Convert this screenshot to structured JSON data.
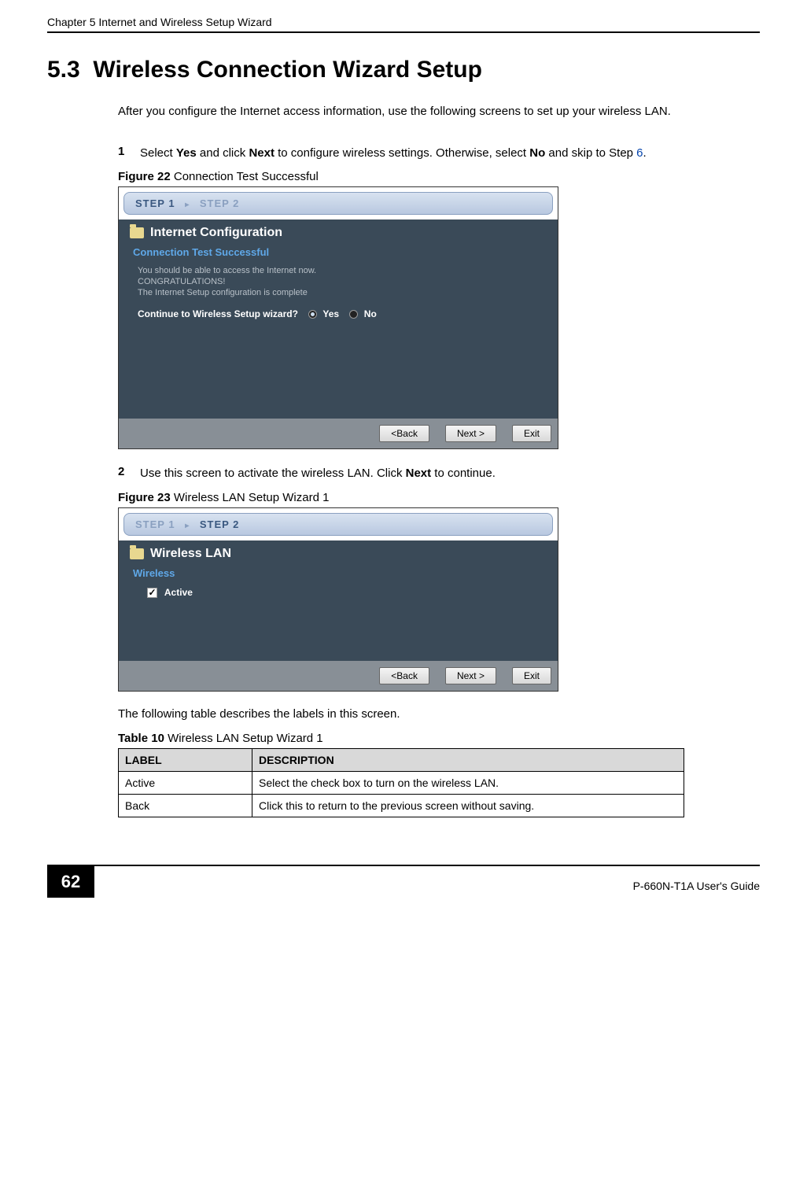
{
  "chapterHeader": "Chapter 5 Internet and Wireless Setup Wizard",
  "sectionNumber": "5.3",
  "sectionTitle": "Wireless Connection Wizard Setup",
  "introText": "After you configure the Internet access information, use the following screens to set up your wireless LAN.",
  "step1": {
    "num": "1",
    "pre": "Select ",
    "b1": "Yes",
    "mid1": " and click ",
    "b2": "Next",
    "mid2": " to configure wireless settings. Otherwise, select ",
    "b3": "No",
    "mid3": " and skip to Step ",
    "link": "6",
    "post": "."
  },
  "figure22": {
    "labelBold": "Figure 22",
    "labelRest": "   Connection Test Successful",
    "step1Label": "STEP 1",
    "step2Label": "STEP 2",
    "folderTitle": "Internet Configuration",
    "blueHeading": "Connection Test Successful",
    "line1": "You should be able to access the Internet now.",
    "line2": "CONGRATULATIONS!",
    "line3": "The Internet Setup configuration is complete",
    "question": "Continue to Wireless Setup wizard?",
    "optYes": "Yes",
    "optNo": "No",
    "btnBack": "<Back",
    "btnNext": "Next >",
    "btnExit": "Exit"
  },
  "step2": {
    "num": "2",
    "pre": "Use this screen to activate the wireless LAN. Click ",
    "b1": "Next",
    "post": " to continue."
  },
  "figure23": {
    "labelBold": "Figure 23",
    "labelRest": "   Wireless LAN Setup Wizard 1",
    "step1Label": "STEP 1",
    "step2Label": "STEP 2",
    "folderTitle": "Wireless LAN",
    "blueHeading": "Wireless",
    "checkboxLabel": "Active",
    "btnBack": "<Back",
    "btnNext": "Next >",
    "btnExit": "Exit"
  },
  "tableIntro": "The following table describes the labels in this screen.",
  "table10": {
    "labelBold": "Table 10",
    "labelRest": "   Wireless LAN Setup Wizard 1",
    "colLabel": "LABEL",
    "colDesc": "DESCRIPTION",
    "rows": [
      {
        "label": "Active",
        "desc": "Select the check box to turn on the wireless LAN."
      },
      {
        "label": "Back",
        "desc": "Click this to return to the previous screen without saving."
      }
    ]
  },
  "footer": {
    "pageNum": "62",
    "guide": "P-660N-T1A User's Guide"
  }
}
